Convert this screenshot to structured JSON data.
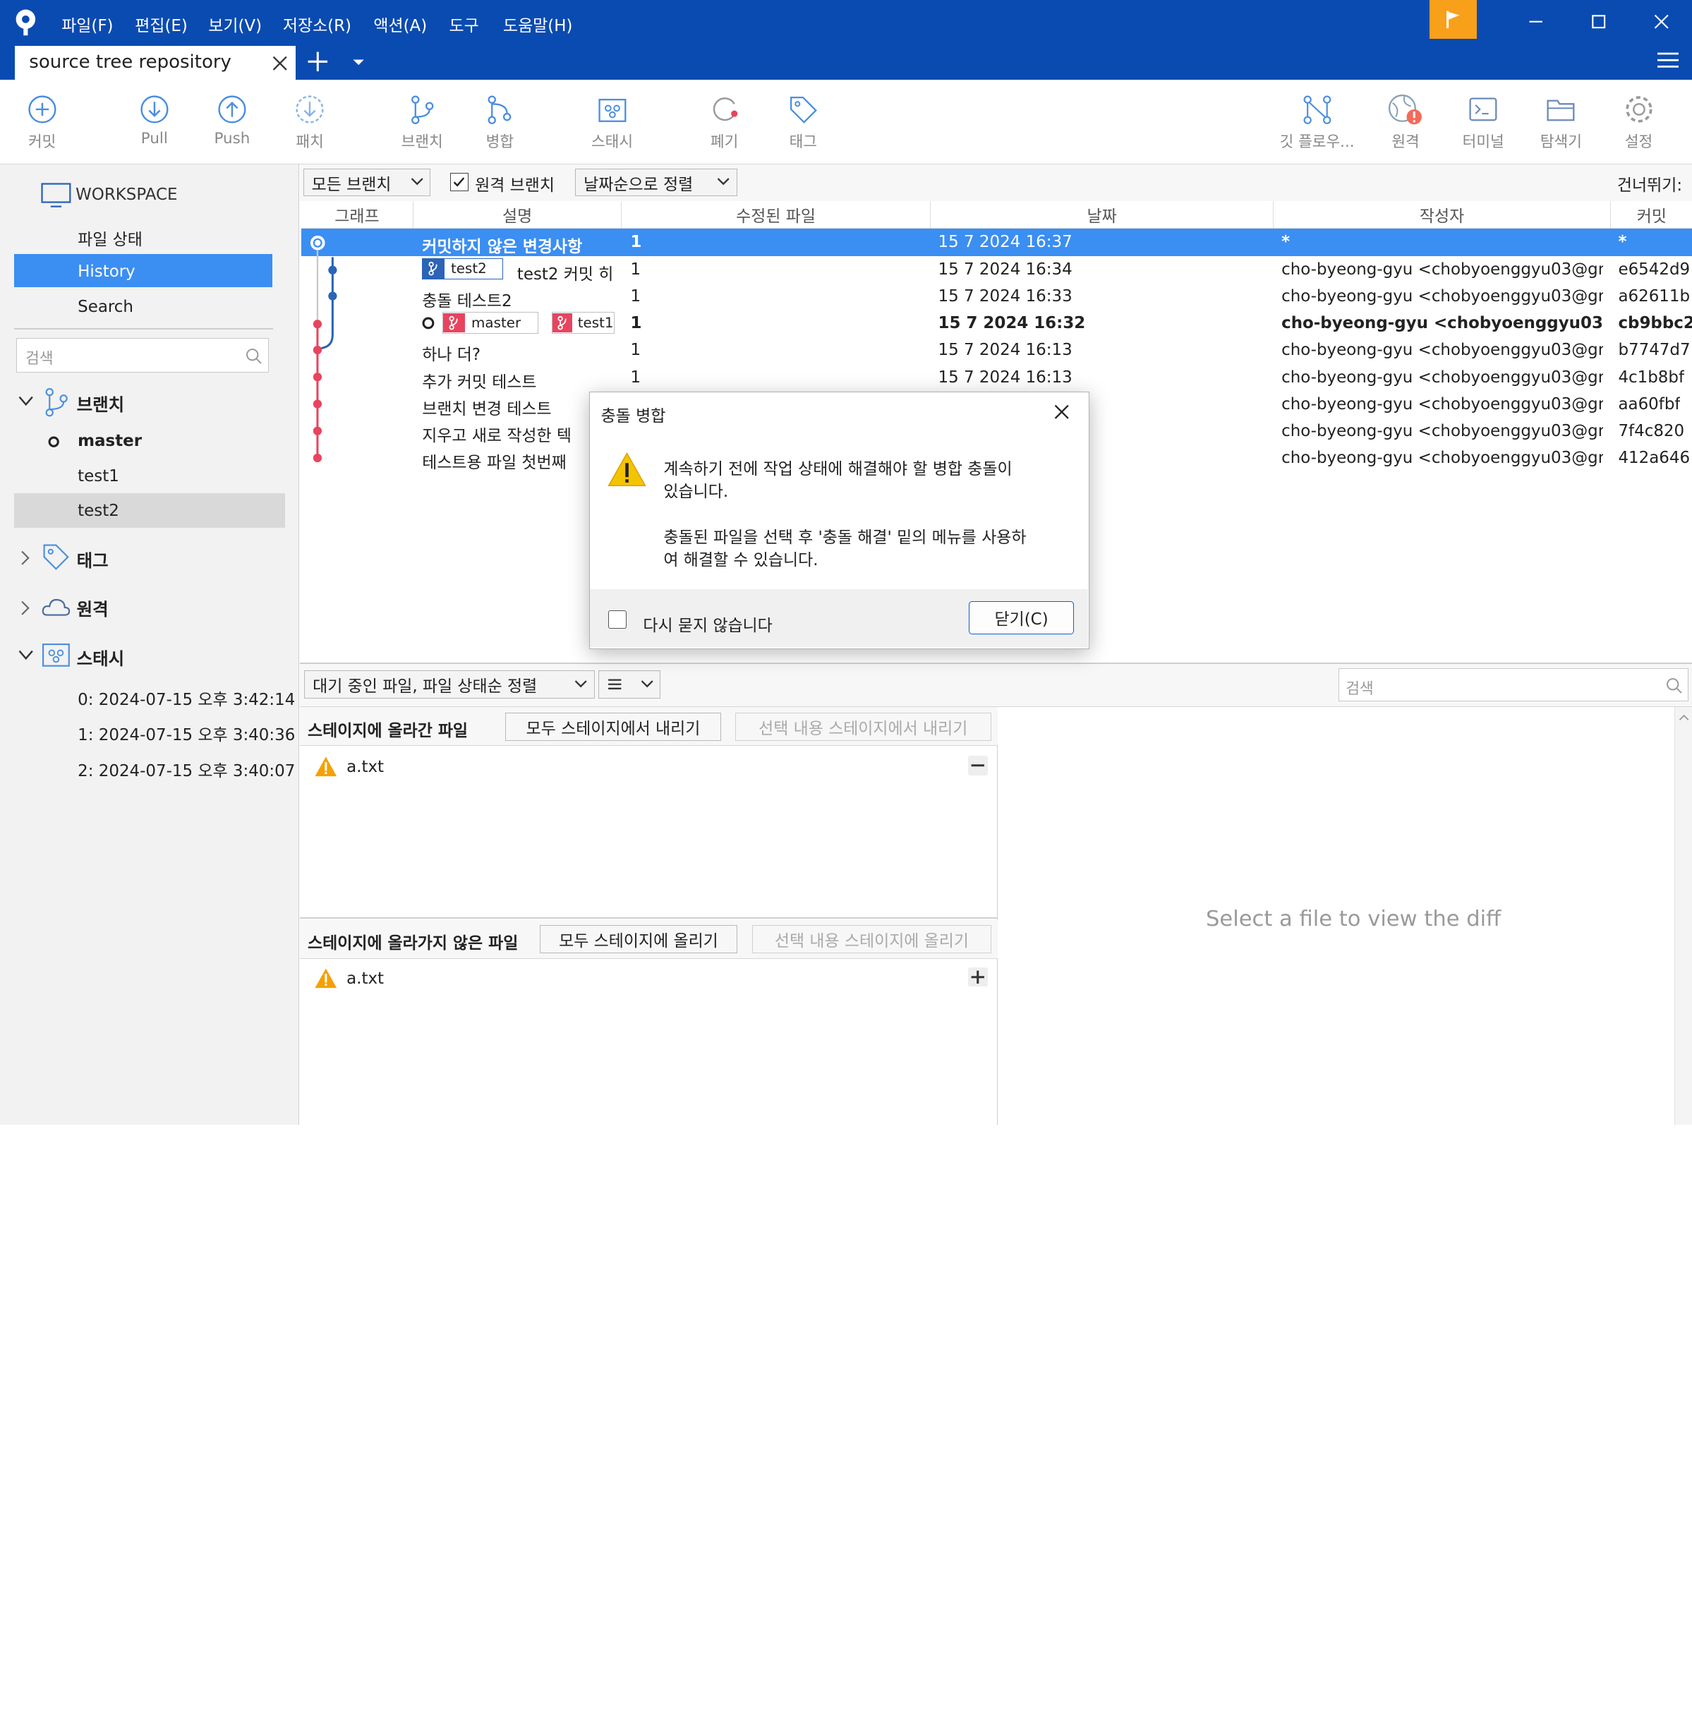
{
  "menu": [
    "파일(F)",
    "편집(E)",
    "보기(V)",
    "저장소(R)",
    "액션(A)",
    "도구",
    "도움말(H)"
  ],
  "tab": {
    "title": "source tree repository"
  },
  "toolbar": {
    "commit": "커밋",
    "pull": "Pull",
    "push": "Push",
    "patch": "패치",
    "branch": "브랜치",
    "merge": "병합",
    "stash": "스태시",
    "discard": "폐기",
    "tag": "태그",
    "gitflow": "깃 플로우...",
    "remote": "원격",
    "terminal": "터미널",
    "explorer": "탐색기",
    "settings": "설정"
  },
  "sidebar": {
    "workspace": "WORKSPACE",
    "file_status": "파일 상태",
    "history": "History",
    "search": "Search",
    "search_placeholder": "검색",
    "branches_label": "브랜치",
    "branches": [
      "master",
      "test1",
      "test2"
    ],
    "tags_label": "태그",
    "remotes_label": "원격",
    "stashes_label": "스태시",
    "stashes": [
      "0: 2024-07-15 오후 3:42:14",
      "1: 2024-07-15 오후 3:40:36",
      "2: 2024-07-15 오후 3:40:07"
    ]
  },
  "filter": {
    "all_branches": "모든 브랜치",
    "remote_branches": "원격 브랜치",
    "sort": "날짜순으로 정렬",
    "skip": "건너뛰기:"
  },
  "columns": [
    "그래프",
    "설명",
    "수정된 파일",
    "날짜",
    "작성자",
    "커밋"
  ],
  "commits": [
    {
      "desc": "커밋하지 않은 변경사항",
      "files": "1",
      "date": "15 7 2024 16:37",
      "author": "*",
      "hash": "*"
    },
    {
      "tag": "test2",
      "desc": "test2 커밋 히",
      "files": "1",
      "date": "15 7 2024 16:34",
      "author": "cho-byeong-gyu <chobyoenggyu03@gm",
      "hash": "e6542d9"
    },
    {
      "desc": "충돌 테스트2",
      "files": "1",
      "date": "15 7 2024 16:33",
      "author": "cho-byeong-gyu <chobyoenggyu03@gm",
      "hash": "a62611b"
    },
    {
      "tag": "master",
      "tag2": "test1",
      "desc": "",
      "files": "1",
      "date": "15 7 2024 16:32",
      "author": "cho-byeong-gyu <chobyoenggyu03@gı",
      "hash": "cb9bbc2"
    },
    {
      "desc": "하나 더?",
      "files": "1",
      "date": "15 7 2024 16:13",
      "author": "cho-byeong-gyu <chobyoenggyu03@gm",
      "hash": "b7747d7"
    },
    {
      "desc": "추가 커밋 테스트",
      "files": "1",
      "date": "15 7 2024 16:13",
      "author": "cho-byeong-gyu <chobyoenggyu03@gm",
      "hash": "4c1b8bf"
    },
    {
      "desc": "브랜치 변경 테스트",
      "files": "",
      "date": "",
      "author": "cho-byeong-gyu <chobyoenggyu03@gm",
      "hash": "aa60fbf"
    },
    {
      "desc": "지우고 새로 작성한 텍",
      "files": "",
      "date": "",
      "author": "cho-byeong-gyu <chobyoenggyu03@gm",
      "hash": "7f4c820"
    },
    {
      "desc": "테스트용 파일 첫번째",
      "files": "",
      "date": "",
      "author": "cho-byeong-gyu <chobyoenggyu03@gm",
      "hash": "412a646"
    }
  ],
  "lower": {
    "pending_sort": "대기 중인 파일, 파일 상태순 정렬",
    "search_placeholder": "검색",
    "staged_title": "스테이지에 올라간 파일",
    "unstage_all": "모두 스테이지에서 내리기",
    "unstage_selected": "선택 내용 스테이지에서 내리기",
    "unstaged_title": "스테이지에 올라가지 않은 파일",
    "stage_all": "모두 스테이지에 올리기",
    "stage_selected": "선택 내용 스테이지에 올리기",
    "staged_file": "a.txt",
    "unstaged_file": "a.txt",
    "diff_placeholder": "Select a file to view the diff"
  },
  "dialog": {
    "title": "충돌 병합",
    "line1": "계속하기 전에 작업 상태에 해결해야 할 병합 충돌이",
    "line2": "있습니다.",
    "line3": "충돌된 파일을 선택 후 '충돌 해결' 밑의 메뉴를 사용하",
    "line4": "여 해결할 수 있습니다.",
    "dont_ask": "다시 묻지 않습니다",
    "close": "닫기(C)"
  },
  "colors": {
    "accent": "#0a4bb1",
    "selection": "#3b8ef2",
    "warning": "#f5a000",
    "graph_red": "#e8445f",
    "graph_blue": "#2b64b8"
  }
}
